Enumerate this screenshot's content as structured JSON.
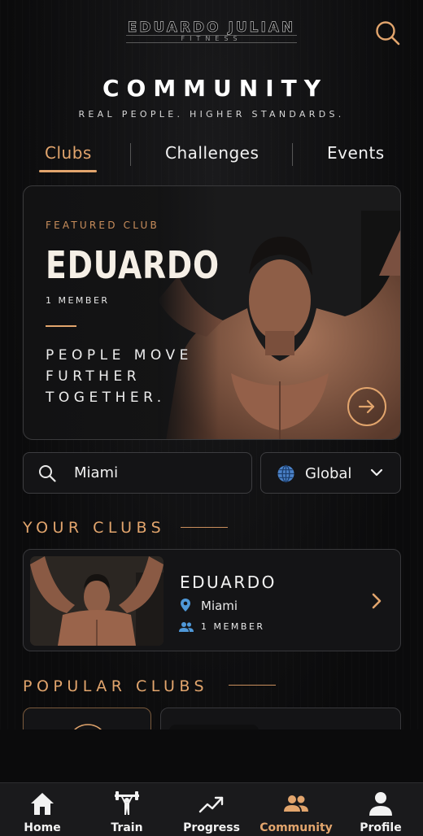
{
  "app": {
    "brand_name": "EDUARDO JULIAN",
    "brand_sub": "FITNESS",
    "accent_color": "#e2a56d"
  },
  "header": {
    "title": "COMMUNITY",
    "subtitle": "REAL PEOPLE. HIGHER STANDARDS.",
    "search_icon": "search-icon"
  },
  "tabs": [
    {
      "label": "Clubs",
      "active": true
    },
    {
      "label": "Challenges",
      "active": false
    },
    {
      "label": "Events",
      "active": false
    }
  ],
  "featured": {
    "label": "FEATURED CLUB",
    "name": "EDUARDO",
    "members": "1 MEMBER",
    "tagline": "PEOPLE MOVE\nFURTHER\nTOGETHER.",
    "arrow_icon": "arrow-right-icon"
  },
  "filters": {
    "search_value": "Miami",
    "region_value": "Global"
  },
  "your_clubs": {
    "title": "YOUR CLUBS",
    "items": [
      {
        "name": "EDUARDO",
        "location": "Miami",
        "members": "1 MEMBER"
      }
    ]
  },
  "popular_clubs": {
    "title": "POPULAR CLUBS"
  },
  "nav": [
    {
      "label": "Home",
      "icon": "home-icon",
      "active": false
    },
    {
      "label": "Train",
      "icon": "dumbbell-person-icon",
      "active": false
    },
    {
      "label": "Progress",
      "icon": "trend-up-icon",
      "active": false
    },
    {
      "label": "Community",
      "icon": "people-icon",
      "active": true
    },
    {
      "label": "Profile",
      "icon": "person-icon",
      "active": false
    }
  ]
}
